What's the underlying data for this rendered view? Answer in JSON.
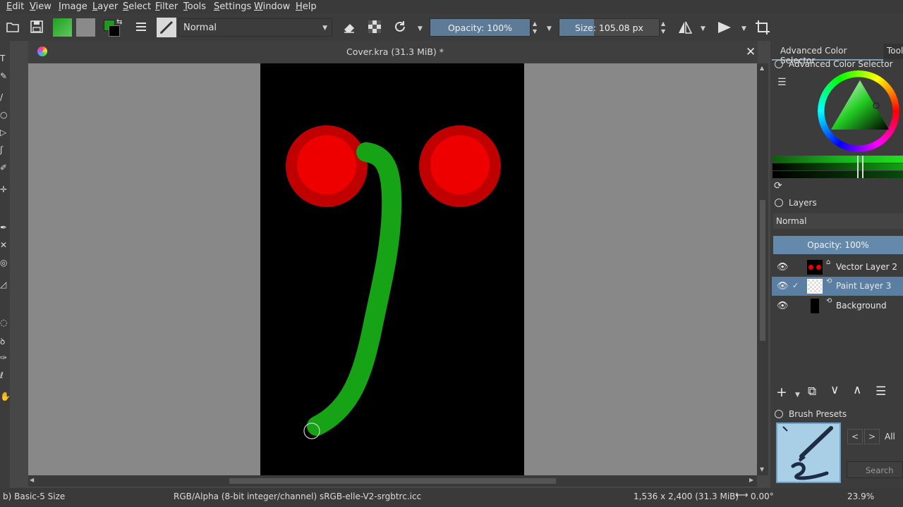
{
  "menu": [
    "Edit",
    "View",
    "Image",
    "Layer",
    "Select",
    "Filter",
    "Tools",
    "Settings",
    "Window",
    "Help"
  ],
  "toolbar": {
    "blend_mode": "Normal",
    "opacity_label": "Opacity: 100%",
    "opacity_value": 1.0,
    "size_label": "Size: 105.08 px",
    "size_value": 0.35
  },
  "document": {
    "title": "Cover.kra (31.3 MiB) *"
  },
  "dock": {
    "tab_color_selector": "Advanced Color Selector",
    "tab_tool": "Tool",
    "color_selector_header": "Advanced Color Selector",
    "layers_header": "Layers",
    "layers_blend": "Normal",
    "layers_opacity": "Opacity:  100%",
    "layers": [
      {
        "name": "Vector Layer 2",
        "selected": false
      },
      {
        "name": "Paint Layer 3",
        "selected": true
      },
      {
        "name": "Background",
        "selected": false
      }
    ],
    "brush_presets_header": "Brush Presets",
    "preset_filter": "All",
    "search_placeholder": "Search"
  },
  "status": {
    "brush": "b) Basic-5 Size",
    "color_space": "RGB/Alpha (8-bit integer/channel)  sRGB-elle-V2-srgbtrc.icc",
    "dimensions": "1,536 x 2,400 (31.3 MiB)",
    "rotation": "0.00°",
    "zoom": "23.9%"
  },
  "colors": {
    "accent": "#5d7a96",
    "selection": "#5a7fa3",
    "canvas": "#000000",
    "brush_stroke": "#16a416",
    "circle_outer": "#c00000",
    "circle_inner": "#ee0000"
  }
}
